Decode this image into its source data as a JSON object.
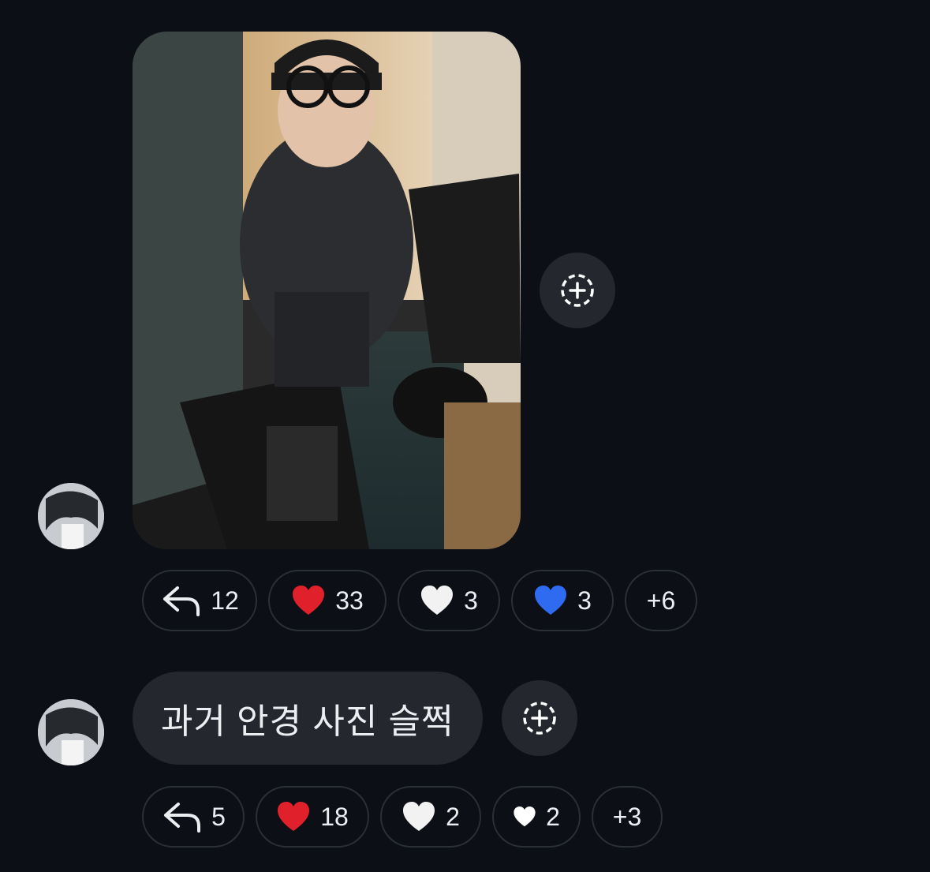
{
  "messages": [
    {
      "type": "image",
      "image_alt": "photo",
      "reactions": [
        {
          "icon": "reply-icon",
          "count": "12"
        },
        {
          "icon": "red-heart-icon",
          "count": "33"
        },
        {
          "icon": "white-heart-icon",
          "count": "3"
        },
        {
          "icon": "blue-heart-icon",
          "count": "3"
        },
        {
          "icon": "",
          "count": "+6"
        }
      ]
    },
    {
      "type": "text",
      "text": "과거 안경 사진 슬쩍",
      "reactions": [
        {
          "icon": "reply-icon",
          "count": "5"
        },
        {
          "icon": "red-heart-icon",
          "count": "18"
        },
        {
          "icon": "white-heart-icon",
          "count": "2"
        },
        {
          "icon": "small-white-heart-icon",
          "count": "2"
        },
        {
          "icon": "",
          "count": "+3"
        }
      ]
    }
  ],
  "colors": {
    "background": "#0c0f15",
    "bubble": "#24272d",
    "chip_border": "#2b2f36",
    "red_heart": "#e0202a",
    "blue_heart": "#2f6bf0",
    "white_heart": "#f2f2f2"
  }
}
